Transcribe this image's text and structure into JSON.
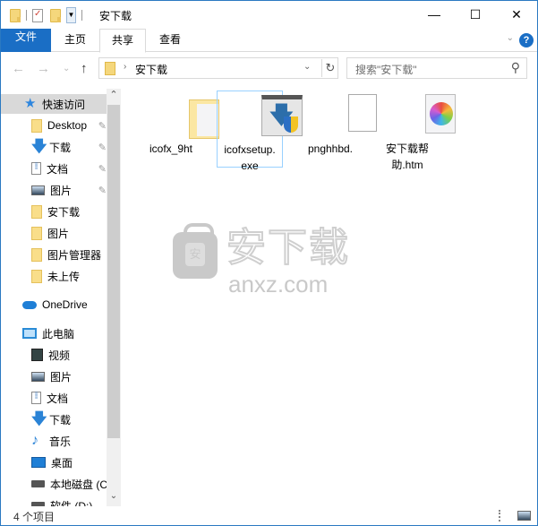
{
  "window": {
    "title": "安下载",
    "controls": {
      "minimize": "—",
      "maximize": "☐",
      "close": "✕"
    }
  },
  "quick_access_toolbar": {
    "items": [
      "folder-icon",
      "properties-icon",
      "new-folder-icon",
      "customize-dropdown"
    ]
  },
  "ribbon": {
    "tabs": [
      {
        "label": "文件",
        "state": "file"
      },
      {
        "label": "主页",
        "state": "normal"
      },
      {
        "label": "共享",
        "state": "active"
      },
      {
        "label": "查看",
        "state": "normal"
      }
    ],
    "expand_icon": "⌄",
    "help_icon": "?"
  },
  "navigation": {
    "back": "←",
    "forward": "→",
    "recent": "⌄",
    "up": "↑",
    "address": {
      "separator": "›",
      "path": "安下载"
    },
    "refresh": "↻",
    "search_placeholder": "搜索\"安下载\"",
    "search_icon": "⌕"
  },
  "sidebar": {
    "quick_access": {
      "label": "快速访问",
      "icon": "star-icon"
    },
    "quick_items": [
      {
        "label": "Desktop",
        "icon": "folder-icon",
        "pinned": true
      },
      {
        "label": "下载",
        "icon": "download-icon",
        "pinned": true
      },
      {
        "label": "文档",
        "icon": "document-icon",
        "pinned": true
      },
      {
        "label": "图片",
        "icon": "pictures-icon",
        "pinned": true
      },
      {
        "label": "安下载",
        "icon": "folder-icon",
        "pinned": false
      },
      {
        "label": "图片",
        "icon": "folder-icon",
        "pinned": false
      },
      {
        "label": "图片管理器",
        "icon": "folder-icon",
        "pinned": false
      },
      {
        "label": "未上传",
        "icon": "folder-icon",
        "pinned": false
      }
    ],
    "onedrive": {
      "label": "OneDrive",
      "icon": "cloud-icon"
    },
    "this_pc": {
      "label": "此电脑",
      "icon": "computer-icon"
    },
    "pc_items": [
      {
        "label": "视频",
        "icon": "video-icon"
      },
      {
        "label": "图片",
        "icon": "pictures-icon"
      },
      {
        "label": "文档",
        "icon": "document-icon"
      },
      {
        "label": "下载",
        "icon": "download-icon"
      },
      {
        "label": "音乐",
        "icon": "music-icon"
      },
      {
        "label": "桌面",
        "icon": "desktop-icon"
      },
      {
        "label": "本地磁盘 (C",
        "icon": "disk-icon"
      },
      {
        "label": "软件 (D:)",
        "icon": "disk-icon"
      }
    ],
    "pin_glyph": "📌"
  },
  "files": [
    {
      "name": "icofx_9ht",
      "type": "folder"
    },
    {
      "name": "icofxsetup.exe",
      "line1": "icofxsetup.",
      "line2": "exe",
      "type": "exe",
      "focused": true
    },
    {
      "name": "pnghhbd.",
      "type": "blank"
    },
    {
      "name": "安下载帮助.htm",
      "line1": "安下载帮",
      "line2": "助.htm",
      "type": "htm"
    }
  ],
  "watermark": {
    "cn": "安下载",
    "en": "anxz.com",
    "badge": "安"
  },
  "status": {
    "count": "4 个项目"
  },
  "colors": {
    "accent": "#1a6ec5",
    "border": "#2b79c2",
    "selection": "#d9d9d9",
    "focus": "#99d1ff"
  }
}
